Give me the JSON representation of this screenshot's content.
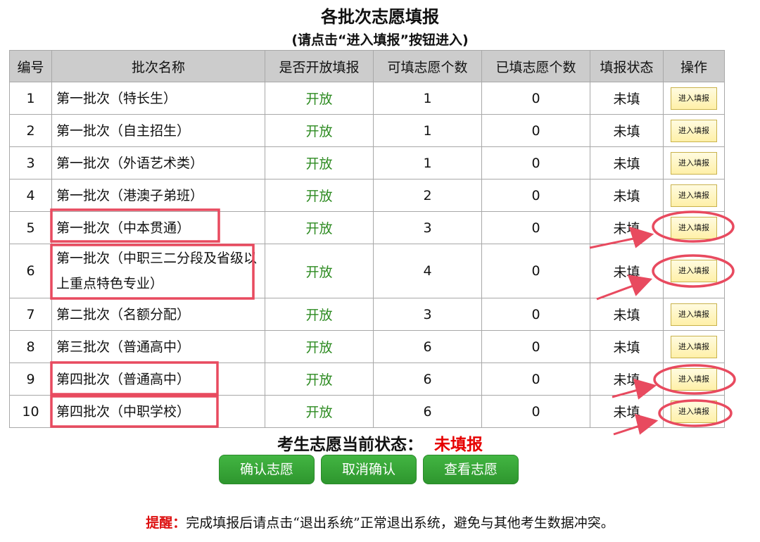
{
  "header": {
    "title": "各批次志愿填报",
    "subtitle": "(请点击“进入填报”按钮进入)"
  },
  "table": {
    "columns": [
      "编号",
      "批次名称",
      "是否开放填报",
      "可填志愿个数",
      "已填志愿个数",
      "填报状态",
      "操作"
    ],
    "rows": [
      {
        "no": "1",
        "name": "第一批次（特长生）",
        "open": "开放",
        "max": "1",
        "filled": "0",
        "status": "未填",
        "action": "进入填报"
      },
      {
        "no": "2",
        "name": "第一批次（自主招生）",
        "open": "开放",
        "max": "1",
        "filled": "0",
        "status": "未填",
        "action": "进入填报"
      },
      {
        "no": "3",
        "name": "第一批次（外语艺术类）",
        "open": "开放",
        "max": "1",
        "filled": "0",
        "status": "未填",
        "action": "进入填报"
      },
      {
        "no": "4",
        "name": "第一批次（港澳子弟班）",
        "open": "开放",
        "max": "2",
        "filled": "0",
        "status": "未填",
        "action": "进入填报"
      },
      {
        "no": "5",
        "name": "第一批次（中本贯通）",
        "open": "开放",
        "max": "3",
        "filled": "0",
        "status": "未填",
        "action": "进入填报"
      },
      {
        "no": "6",
        "name": "第一批次（中职三二分段及省级以上重点特色专业）",
        "open": "开放",
        "max": "4",
        "filled": "0",
        "status": "未填",
        "action": "进入填报"
      },
      {
        "no": "7",
        "name": "第二批次（名额分配）",
        "open": "开放",
        "max": "3",
        "filled": "0",
        "status": "未填",
        "action": "进入填报"
      },
      {
        "no": "8",
        "name": "第三批次（普通高中）",
        "open": "开放",
        "max": "6",
        "filled": "0",
        "status": "未填",
        "action": "进入填报"
      },
      {
        "no": "9",
        "name": "第四批次（普通高中）",
        "open": "开放",
        "max": "6",
        "filled": "0",
        "status": "未填",
        "action": "进入填报"
      },
      {
        "no": "10",
        "name": "第四批次（中职学校）",
        "open": "开放",
        "max": "6",
        "filled": "0",
        "status": "未填",
        "action": "进入填报"
      }
    ]
  },
  "status": {
    "label": "考生志愿当前状态：",
    "value": "未填报"
  },
  "actions": {
    "confirm": "确认志愿",
    "cancel": "取消确认",
    "view": "查看志愿"
  },
  "notice": {
    "label": "提醒：",
    "text": "完成填报后请点击“退出系统”正常退出系统，避免与其他考生数据冲突。"
  },
  "colors": {
    "open_green": "#2e8b22",
    "status_red": "#e60000",
    "button_green": "#34a634",
    "annotation_red": "#e84a5f",
    "header_gray": "#cccccc"
  }
}
